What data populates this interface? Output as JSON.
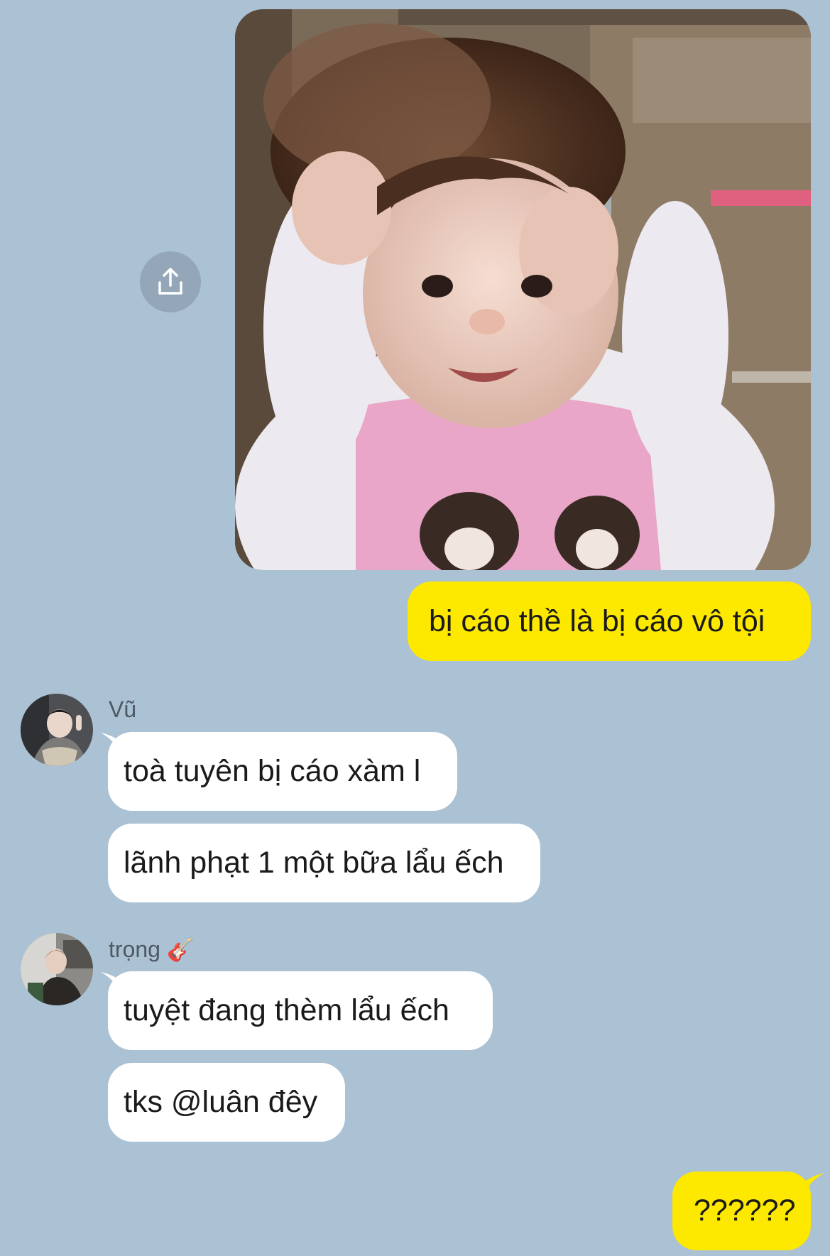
{
  "messages": {
    "outgoing_1": "bị cáo thề là bị cáo vô tội",
    "outgoing_2": "??????",
    "group_vu": {
      "sender": "Vũ",
      "lines": [
        "toà tuyên bị cáo xàm l",
        "lãnh phạt 1 một bữa lẩu ếch"
      ]
    },
    "group_trong": {
      "sender": "trọng",
      "sender_emoji": "🎸",
      "lines": [
        "tuyệt đang thèm lẩu ếch",
        "tks @luân đêy"
      ]
    }
  },
  "icons": {
    "share": "share-icon",
    "guitar": "guitar-icon"
  },
  "colors": {
    "background": "#abc1d4",
    "outgoing_bubble": "#fde800",
    "incoming_bubble": "#ffffff",
    "share_button": "#93a7b8"
  }
}
